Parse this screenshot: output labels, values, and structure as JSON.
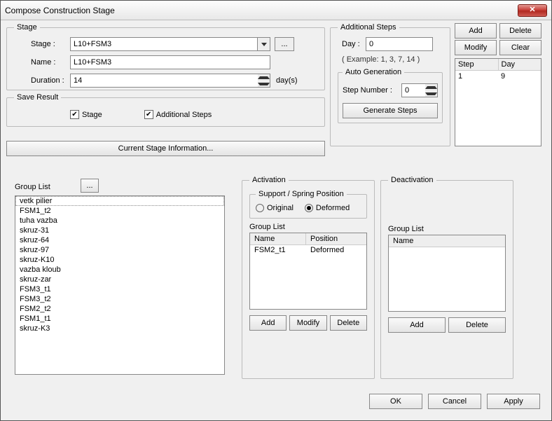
{
  "window": {
    "title": "Compose Construction Stage",
    "close_label": "✕"
  },
  "stage": {
    "legend": "Stage",
    "label_stage": "Stage :",
    "label_name": "Name :",
    "label_duration": "Duration :",
    "value_stage": "L10+FSM3",
    "value_name": "L10+FSM3",
    "value_duration": "14",
    "unit_duration": "day(s)",
    "more_label": "..."
  },
  "save": {
    "legend": "Save Result",
    "chk_stage": "Stage",
    "chk_steps": "Additional Steps"
  },
  "csi_btn": "Current Stage Information...",
  "addsteps": {
    "legend": "Additional Steps",
    "label_day": "Day :",
    "value_day": "0",
    "example": "( Example: 1, 3, 7, 14  )",
    "autogen_legend": "Auto Generation",
    "label_step_number": "Step Number  :",
    "value_step_number": "0",
    "btn_generate": "Generate Steps"
  },
  "steps_side": {
    "btn_add": "Add",
    "btn_delete": "Delete",
    "btn_modify": "Modify",
    "btn_clear": "Clear",
    "hdr_step": "Step",
    "hdr_day": "Day",
    "rows": [
      {
        "step": "1",
        "day": "9"
      }
    ]
  },
  "group_list": {
    "label": "Group List",
    "dots": "...",
    "items": [
      "vetk pilier",
      "FSM1_t2",
      "tuha vazba",
      "skruz-31",
      "skruz-64",
      "skruz-97",
      "skruz-K10",
      "vazba kloub",
      "skruz-zar",
      "FSM3_t1",
      "FSM3_t2",
      "FSM2_t2",
      "FSM1_t1",
      "skruz-K3"
    ]
  },
  "activation": {
    "legend": "Activation",
    "support_legend": "Support / Spring Position",
    "radio_original": "Original",
    "radio_deformed": "Deformed",
    "label_grouplist": "Group List",
    "hdr_name": "Name",
    "hdr_pos": "Position",
    "rows": [
      {
        "name": "FSM2_t1",
        "pos": "Deformed"
      }
    ],
    "btn_add": "Add",
    "btn_modify": "Modify",
    "btn_delete": "Delete"
  },
  "deactivation": {
    "legend": "Deactivation",
    "label_grouplist": "Group List",
    "hdr_name": "Name",
    "btn_add": "Add",
    "btn_delete": "Delete"
  },
  "dialog_buttons": {
    "ok": "OK",
    "cancel": "Cancel",
    "apply": "Apply"
  }
}
